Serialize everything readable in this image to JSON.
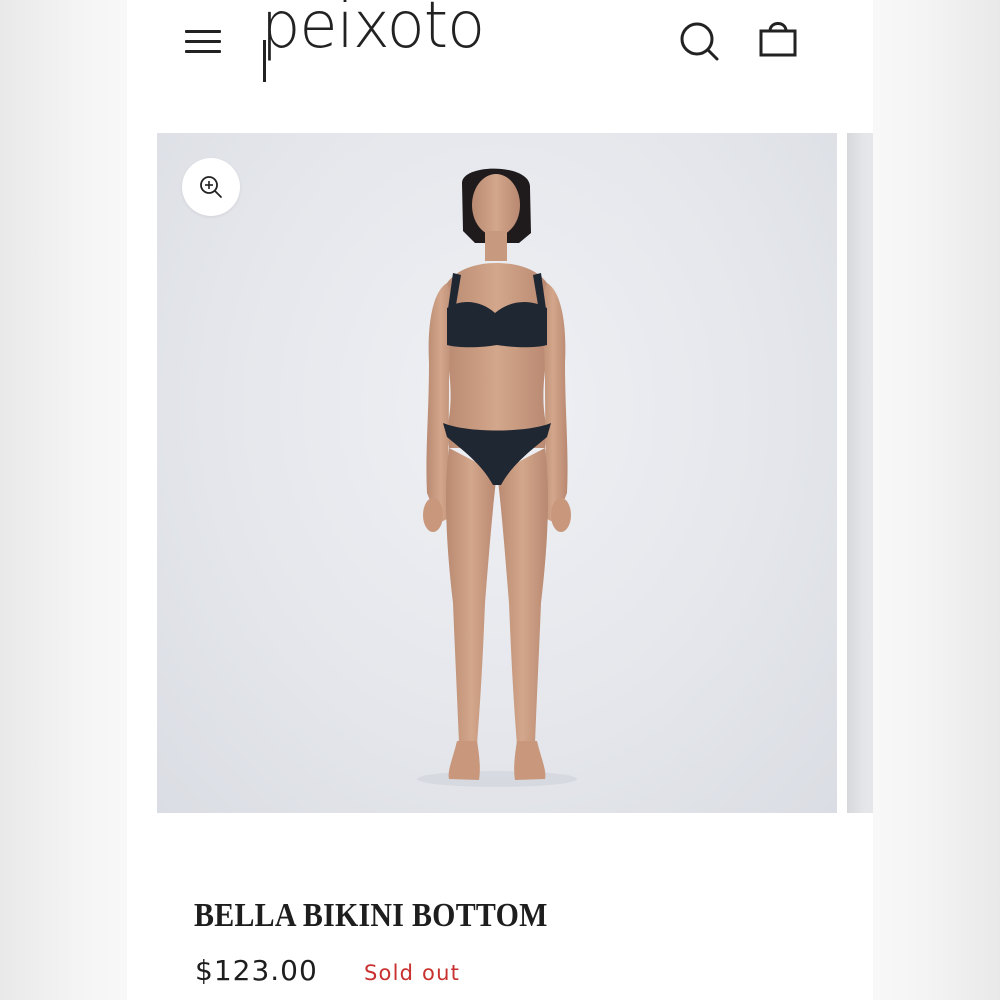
{
  "brand": {
    "logo_text": "peixoto"
  },
  "header": {
    "menu_icon": "hamburger-menu-icon",
    "search_icon": "search-icon",
    "cart_icon": "shopping-bag-icon"
  },
  "gallery": {
    "zoom_icon": "zoom-in-icon",
    "main_image_alt": "Model wearing black bikini",
    "next_image_alt": ""
  },
  "product": {
    "title": "BELLA BIKINI BOTTOM",
    "price": "$123.00",
    "availability": "Sold out"
  },
  "colors": {
    "text": "#1e1e1e",
    "sold_out": "#c8312f",
    "image_background": "#e6e8ec",
    "swimsuit": "#1f2733"
  }
}
